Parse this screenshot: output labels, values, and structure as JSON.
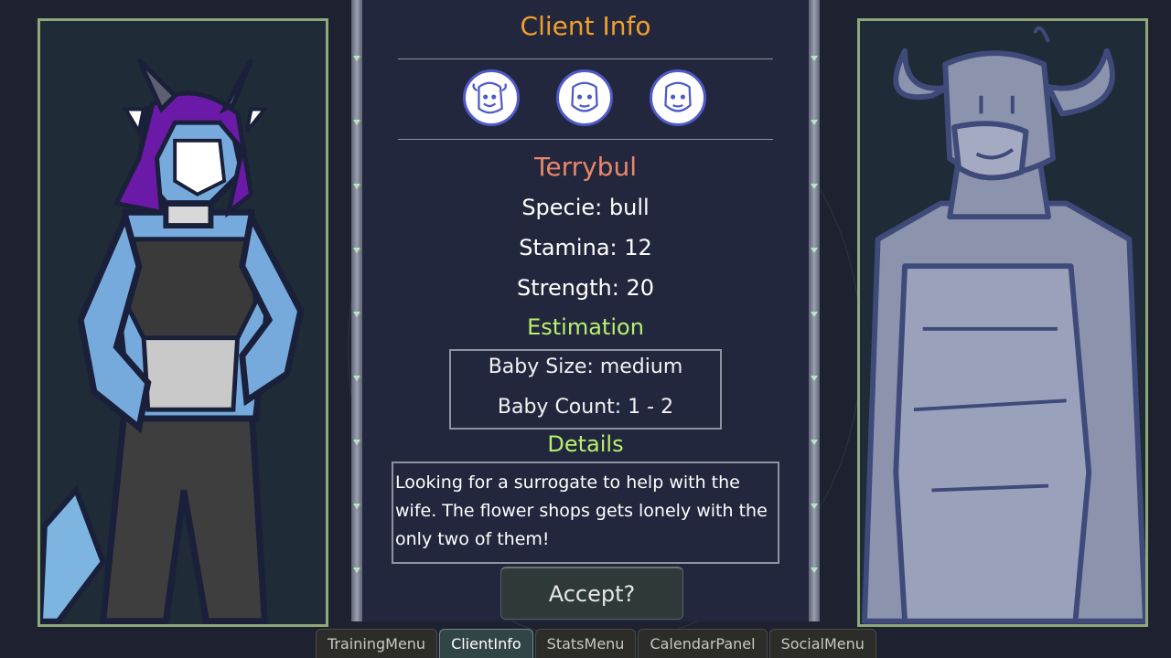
{
  "client_info": {
    "title": "Client Info",
    "client_icons": [
      "client-bull-icon",
      "client-face-icon",
      "client-face-icon"
    ],
    "name": "Terrybul",
    "specie": "Specie: bull",
    "stamina": "Stamina: 12",
    "strength": "Strength: 20",
    "estimation_heading": "Estimation",
    "baby_size": "Baby Size: medium",
    "baby_count": "Baby Count: 1 - 2",
    "details_heading": "Details",
    "details_text": "Looking for a  surrogate to help with the wife. The flower shops gets lonely with the only two of them!",
    "accept_label": "Accept?"
  },
  "tabs": [
    {
      "label": "TrainingMenu",
      "active": false
    },
    {
      "label": "ClientInfo",
      "active": true
    },
    {
      "label": "StatsMenu",
      "active": false
    },
    {
      "label": "CalendarPanel",
      "active": false
    },
    {
      "label": "SocialMenu",
      "active": false
    }
  ],
  "colors": {
    "title": "#f0a02a",
    "name": "#e8876a",
    "section": "#b7f06e",
    "frame": "#8ea87a",
    "panel": "#23273d"
  }
}
